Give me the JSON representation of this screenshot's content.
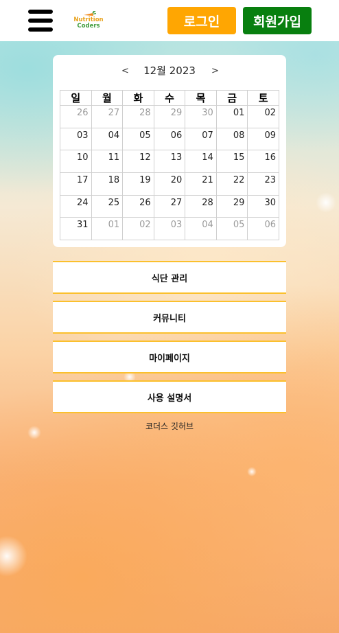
{
  "header": {
    "logo_line1": "Nutrition",
    "logo_line2": "Coders",
    "login_label": "로그인",
    "signup_label": "회원가입"
  },
  "calendar": {
    "prev": "<",
    "next": ">",
    "title": "12월 2023",
    "weekdays": [
      "일",
      "월",
      "화",
      "수",
      "목",
      "금",
      "토"
    ],
    "weeks": [
      [
        "26",
        "27",
        "28",
        "29",
        "30",
        "01",
        "02"
      ],
      [
        "03",
        "04",
        "05",
        "06",
        "07",
        "08",
        "09"
      ],
      [
        "10",
        "11",
        "12",
        "13",
        "14",
        "15",
        "16"
      ],
      [
        "17",
        "18",
        "19",
        "20",
        "21",
        "22",
        "23"
      ],
      [
        "24",
        "25",
        "26",
        "27",
        "28",
        "29",
        "30"
      ],
      [
        "31",
        "01",
        "02",
        "03",
        "04",
        "05",
        "06"
      ]
    ]
  },
  "menu": {
    "items": [
      "식단 관리",
      "커뮤니티",
      "마이페이지",
      "사용 설명서"
    ]
  },
  "footer": {
    "github_link": "코더스 깃허브"
  },
  "colors": {
    "login_bg": "#ffa602",
    "signup_bg": "#087f0f",
    "menu_border": "#fbc02d"
  }
}
